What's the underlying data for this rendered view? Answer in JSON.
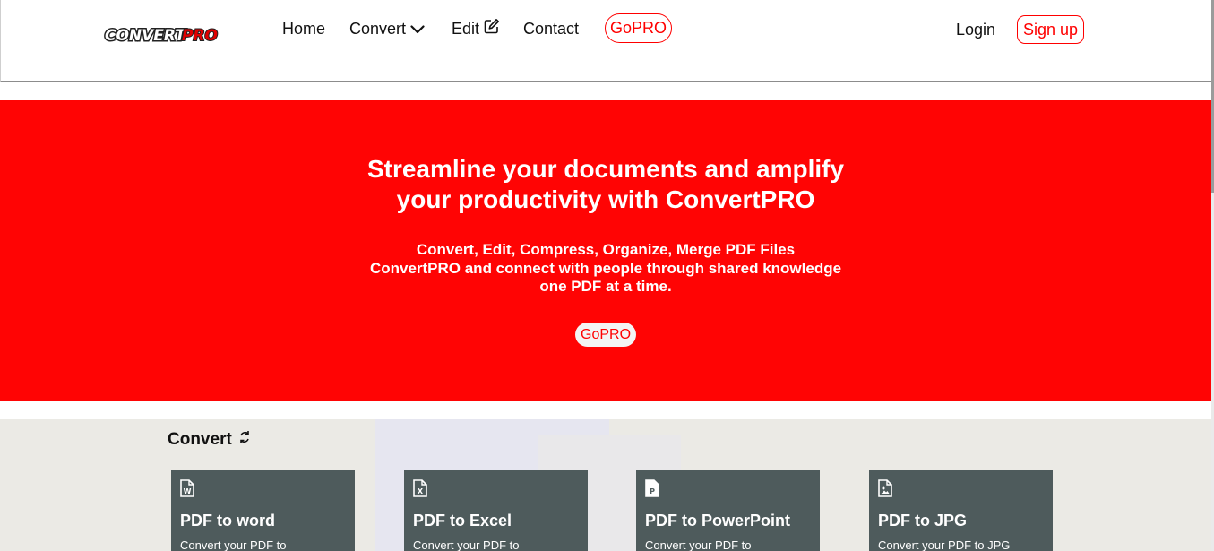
{
  "header": {
    "logo_text": "ConvertPRO",
    "nav": {
      "home": "Home",
      "convert": "Convert",
      "edit": "Edit",
      "contact": "Contact",
      "gopro": "GoPRO"
    },
    "login": "Login",
    "signup": "Sign up"
  },
  "hero": {
    "title": "Streamline your documents and amplify your productivity with ConvertPRO",
    "sub_lines": [
      "Convert, Edit, Compress, Organize, Merge PDF Files",
      "ConvertPRO and connect with people through shared knowledge",
      "one PDF at a time."
    ],
    "button": "GoPRO"
  },
  "convert_section": {
    "title": "Convert",
    "cards": [
      {
        "icon": "word-file-icon",
        "title": "PDF to word",
        "desc": "Convert your PDF to"
      },
      {
        "icon": "excel-file-icon",
        "title": "PDF to Excel",
        "desc": "Convert your PDF to"
      },
      {
        "icon": "powerpoint-file-icon",
        "title": "PDF to PowerPoint",
        "desc": "Convert your PDF to"
      },
      {
        "icon": "image-file-icon",
        "title": "PDF to JPG",
        "desc": "Convert your PDF to JPG"
      }
    ]
  },
  "colors": {
    "brand_red": "#ff0404",
    "card_bg": "#4e5b5c",
    "section_bg": "#ebeae5"
  }
}
